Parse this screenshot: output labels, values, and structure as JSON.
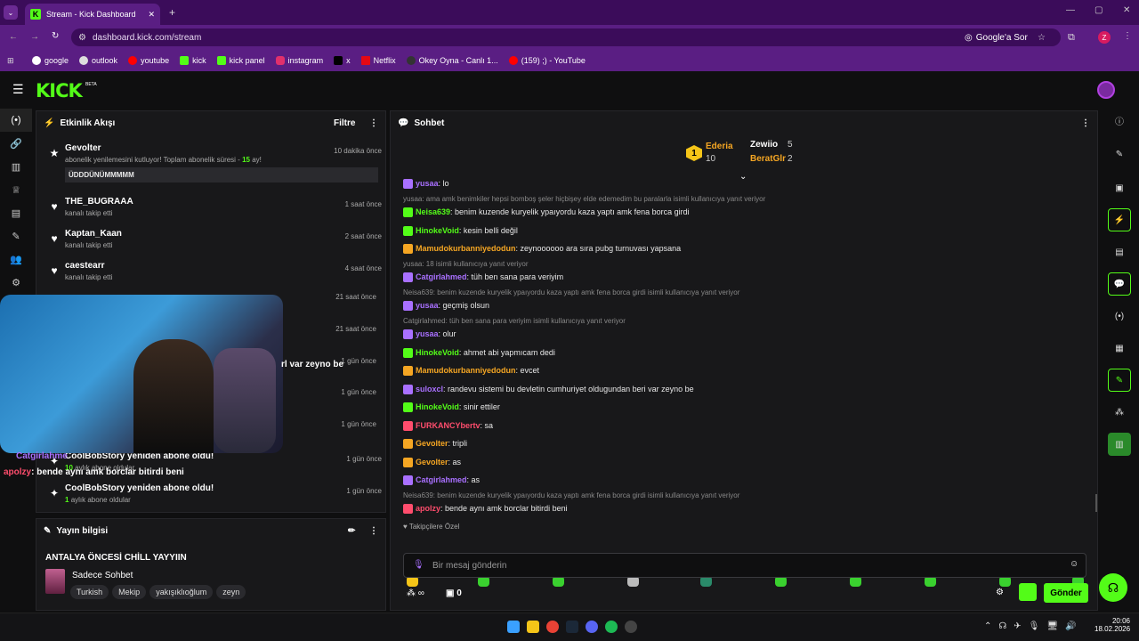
{
  "browser": {
    "tab_title": "Stream - Kick Dashboard",
    "url": "dashboard.kick.com/stream",
    "google_btn": "Google'a Sor",
    "profile": "Z"
  },
  "bookmarks": [
    "google",
    "outlook",
    "youtube",
    "kick",
    "kick panel",
    "instagram",
    "x",
    "Netflix",
    "Okey Oyna - Canlı 1...",
    "(159) ;) - YouTube"
  ],
  "header": {
    "logo": "KICK",
    "beta": "BETA"
  },
  "activity": {
    "title": "Etkinlik Akışı",
    "filter": "Filtre",
    "items": [
      {
        "name": "Gevolter",
        "sub": "abonelik yenilemesini kutluyor! Toplam abonelik süresi - ",
        "months": "15",
        "sub2": " ay!",
        "time": "10 dakika önce",
        "message": "ÜDDDÜNÜMMMMM"
      },
      {
        "name": "THE_BUGRAAA",
        "sub": "kanalı takip etti",
        "time": "1 saat önce"
      },
      {
        "name": "Kaptan_Kaan",
        "sub": "kanalı takip etti",
        "time": "2 saat önce"
      },
      {
        "name": "caestearr",
        "sub": "kanalı takip etti",
        "time": "4 saat önce"
      },
      {
        "time": "21 saat önce"
      },
      {
        "time": "21 saat önce"
      },
      {
        "time": "1 gün önce"
      },
      {
        "time": "1 gün önce"
      },
      {
        "time": "1 gün önce"
      },
      {
        "name": "CoolBobStory yeniden abone oldu!",
        "count": "10",
        "sub": "aylık abone oldular",
        "time": "1 gün önce"
      },
      {
        "name": "CoolBobStory yeniden abone oldu!",
        "count": "1",
        "sub": "aylık abone oldular",
        "time": "1 gün önce"
      }
    ]
  },
  "overlay": {
    "line1": "rl var zeyno be",
    "user1": "Catgirlahme",
    "user2": "apolzy",
    "msg2": ": bende aynı amk borclar bitirdi beni"
  },
  "stream_info": {
    "title": "Yayın bilgisi",
    "stream_title": "ANTALYA ÖNCESİ CHİLL YAYYIIN",
    "category": "Sadece Sohbet",
    "tags": [
      "Turkish",
      "Mekip",
      "yakışıklıoğlum",
      "zeyn"
    ]
  },
  "chat": {
    "title": "Sohbet",
    "leaders": [
      {
        "name": "Ederia",
        "count": "10"
      },
      {
        "name": "Zewiio",
        "count": "5"
      },
      {
        "name": "BeratGlr",
        "count": "2"
      }
    ],
    "rank": "1",
    "lines": [
      {
        "type": "msg",
        "user": "yusaa",
        "color": "#a970ff",
        "text": ": lo"
      },
      {
        "type": "reply",
        "text": "yusaa: ama amk benimkiler hepsi bomboş şeler hiçbişey elde edemedim bu paralarla isimli kullanıcıya yanıt veriyor"
      },
      {
        "type": "msg",
        "user": "Neisa639",
        "color": "#53fc18",
        "text": ": benim kuzende kuryelik ypaıyordu kaza yaptı amk fena borca girdi"
      },
      {
        "type": "msg",
        "user": "HinokeVoid",
        "color": "#53fc18",
        "text": ": kesin belli değil"
      },
      {
        "type": "msg",
        "user": "Mamudokurbanniyedodun",
        "color": "#f5a623",
        "text": ": zeynoooooo ara sıra pubg turnuvası yapsana"
      },
      {
        "type": "reply",
        "text": "yusaa: 18 isimli kullanıcıya yanıt veriyor"
      },
      {
        "type": "msg",
        "user": "Catgirlahmed",
        "color": "#a970ff",
        "text": ": tüh ben sana para veriyim"
      },
      {
        "type": "reply",
        "text": "Neisa639: benim kuzende kuryelik ypaıyordu kaza yaptı amk fena borca girdi isimli kullanıcıya yanıt veriyor"
      },
      {
        "type": "msg",
        "user": "yusaa",
        "color": "#a970ff",
        "text": ": geçmiş olsun"
      },
      {
        "type": "reply",
        "text": "Catgirlahmed: tüh ben sana para veriyim isimli kullanıcıya yanıt veriyor"
      },
      {
        "type": "msg",
        "user": "yusaa",
        "color": "#a970ff",
        "text": ": olur"
      },
      {
        "type": "msg",
        "user": "HinokeVoid",
        "color": "#53fc18",
        "text": ": ahmet abi yapmıcam dedi"
      },
      {
        "type": "msg",
        "user": "Mamudokurbanniyedodun",
        "color": "#f5a623",
        "text": ": evcet"
      },
      {
        "type": "msg",
        "user": "suloxcl",
        "color": "#a970ff",
        "text": ": randevu sistemi bu devletin cumhuriyet oldugundan beri var zeyno be"
      },
      {
        "type": "msg",
        "user": "HinokeVoid",
        "color": "#53fc18",
        "text": ": sinir ettiler"
      },
      {
        "type": "msg",
        "user": "FURKANCYbertv",
        "color": "#ff4d6d",
        "text": ": sa"
      },
      {
        "type": "msg",
        "user": "Gevolter",
        "color": "#f5a623",
        "text": ": tripli"
      },
      {
        "type": "msg",
        "user": "Gevolter",
        "color": "#f5a623",
        "text": ": as"
      },
      {
        "type": "msg",
        "user": "Catgirlahmed",
        "color": "#a970ff",
        "text": ": as"
      },
      {
        "type": "reply",
        "text": "Neisa639: benim kuzende kuryelik ypaıyordu kaza yaptı amk fena borca girdi isimli kullanıcıya yanıt veriyor"
      },
      {
        "type": "msg",
        "user": "apolzy",
        "color": "#ff4d6d",
        "text": ": bende aynı amk borclar bitirdi beni"
      }
    ],
    "followers_label": "Takipçilere Özel",
    "input_placeholder": "Bir mesaj gönderin",
    "infinity": "∞",
    "points": "0",
    "send": "Gönder"
  },
  "taskbar": {
    "time": "20:06",
    "date": "18.02.2026"
  }
}
